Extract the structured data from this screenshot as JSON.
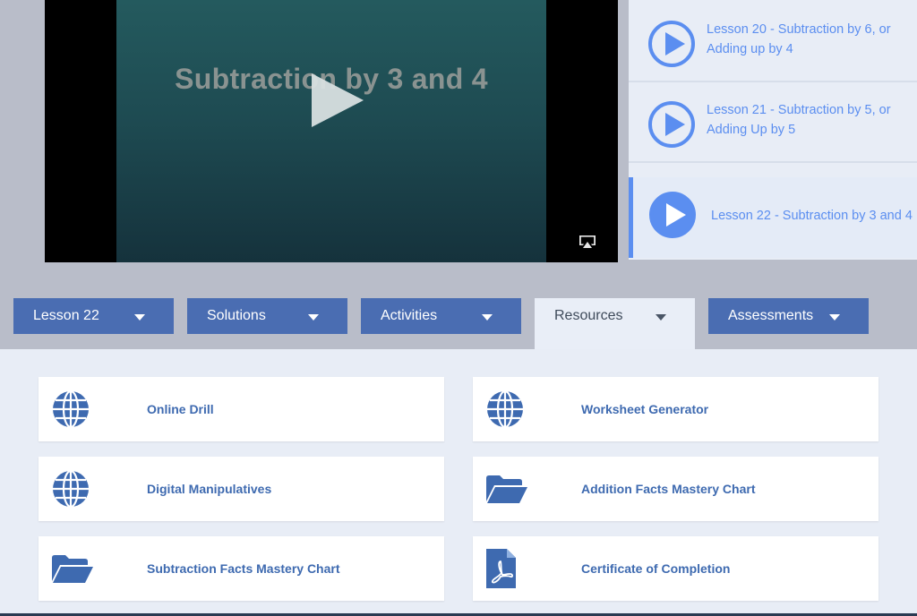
{
  "video": {
    "title": "Subtraction by 3 and 4"
  },
  "playlist": {
    "items": [
      {
        "label": "Lesson 20 - Subtraction by 6, or Adding up by 4",
        "active": false
      },
      {
        "label": "Lesson 21 - Subtraction by 5, or Adding Up by 5",
        "active": false
      },
      {
        "label": "Lesson 22 - Subtraction by 3 and 4",
        "active": true
      }
    ]
  },
  "tabs": [
    {
      "label": "Lesson 22",
      "active": false
    },
    {
      "label": "Solutions",
      "active": false
    },
    {
      "label": "Activities",
      "active": false
    },
    {
      "label": "Resources",
      "active": true
    },
    {
      "label": "Assessments",
      "active": false
    }
  ],
  "resources": [
    {
      "label": "Online Drill",
      "icon": "globe-icon"
    },
    {
      "label": "Worksheet Generator",
      "icon": "globe-icon"
    },
    {
      "label": "Digital Manipulatives",
      "icon": "globe-icon"
    },
    {
      "label": "Addition Facts Mastery Chart",
      "icon": "folder-icon"
    },
    {
      "label": "Subtraction Facts Mastery Chart",
      "icon": "folder-icon"
    },
    {
      "label": "Certificate of Completion",
      "icon": "pdf-icon"
    }
  ],
  "colors": {
    "accent": "#5b8ef0",
    "tab_bg": "#4a6db2",
    "icon": "#3e6ab0"
  }
}
